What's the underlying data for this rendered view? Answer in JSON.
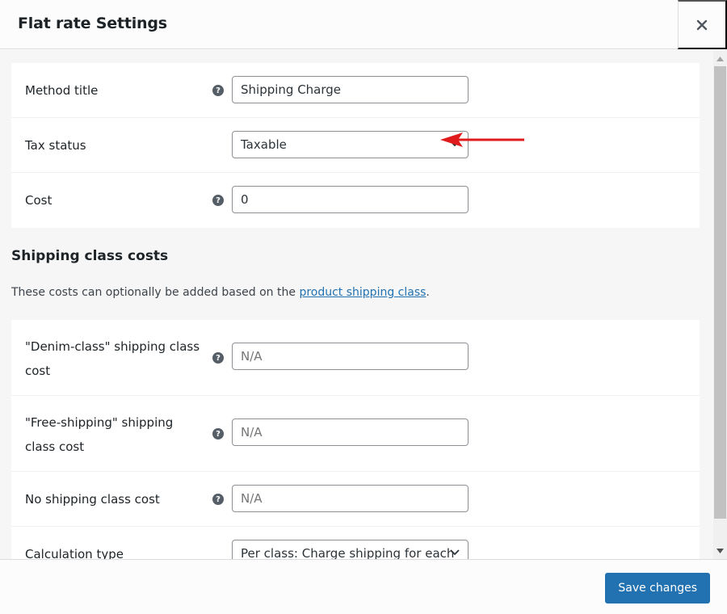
{
  "modal": {
    "title": "Flat rate Settings",
    "close_icon": "close-icon"
  },
  "general_fields": [
    {
      "label": "Method title",
      "type": "text",
      "value": "Shipping Charge",
      "help": true
    },
    {
      "label": "Tax status",
      "type": "select",
      "value": "Taxable",
      "help": false
    },
    {
      "label": "Cost",
      "type": "text",
      "value": "0",
      "help": true
    }
  ],
  "shipping_class_section": {
    "title": "Shipping class costs",
    "description_prefix": "These costs can optionally be added based on the ",
    "link_text": "product shipping class",
    "description_suffix": "."
  },
  "class_fields": [
    {
      "label_line1": "\"Denim-class\" shipping class",
      "label_line2": "cost",
      "placeholder": "N/A",
      "value": "",
      "help": true
    },
    {
      "label_line1": "\"Free-shipping\" shipping",
      "label_line2": "class cost",
      "placeholder": "N/A",
      "value": "",
      "help": true
    },
    {
      "label_line1": "No shipping class cost",
      "label_line2": "",
      "placeholder": "N/A",
      "value": "",
      "help": true
    },
    {
      "label_line1": "Calculation type",
      "label_line2": "",
      "type": "select",
      "value": "Per class: Charge shipping for each",
      "help": false
    }
  ],
  "help_glyph": "?",
  "footer": {
    "save_label": "Save changes"
  },
  "annotation": {
    "arrow_color": "#e01b1b"
  },
  "colors": {
    "primary": "#2271b1",
    "link": "#2271b1"
  }
}
